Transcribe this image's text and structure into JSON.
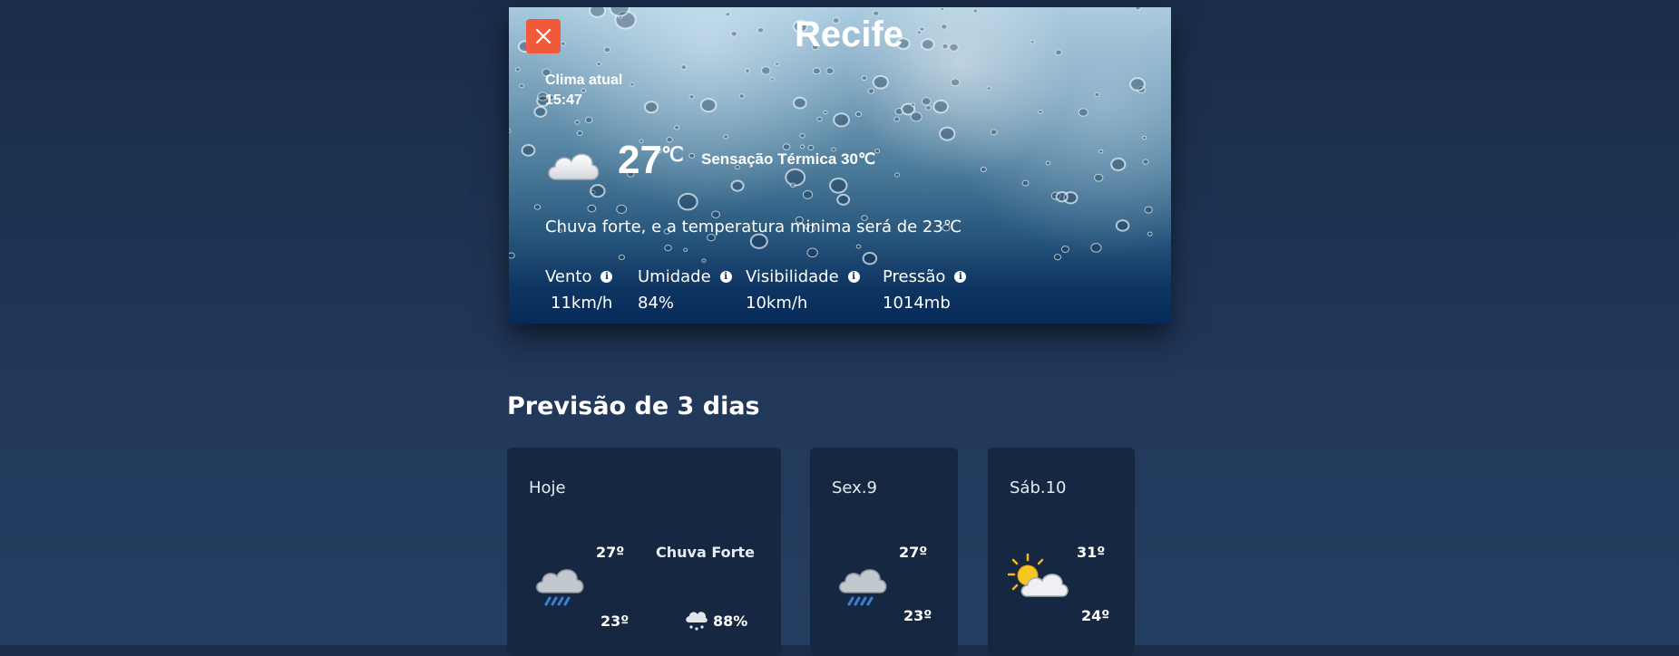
{
  "current": {
    "city": "Recife",
    "label": "Clima atual",
    "time": "15:47",
    "temperature": "27",
    "unit": "℃",
    "feels_like": "Sensação Térmica 30℃",
    "description": "Chuva forte, e a temperatura minima será de 23℃",
    "icon": "cloud-icon",
    "stats": [
      {
        "label": "Vento",
        "value": "11km/h"
      },
      {
        "label": "Umidade",
        "value": "84%"
      },
      {
        "label": "Visibilidade",
        "value": "10km/h"
      },
      {
        "label": "Pressão",
        "value": "1014mb"
      }
    ]
  },
  "forecast": {
    "title": "Previsão de 3 dias",
    "days": [
      {
        "label": "Hoje",
        "high": "27º",
        "low": "23º",
        "condition": "Chuva Forte",
        "rain_chance": "88%",
        "icon": "rain-cloud-icon"
      },
      {
        "label": "Sex.9",
        "high": "27º",
        "low": "23º",
        "icon": "rain-cloud-icon"
      },
      {
        "label": "Sáb.10",
        "high": "31º",
        "low": "24º",
        "icon": "partly-sunny-icon"
      }
    ]
  },
  "colors": {
    "close_button": "#f05a3a",
    "card_bg": "#162841",
    "page_bg": "#1f3454"
  }
}
